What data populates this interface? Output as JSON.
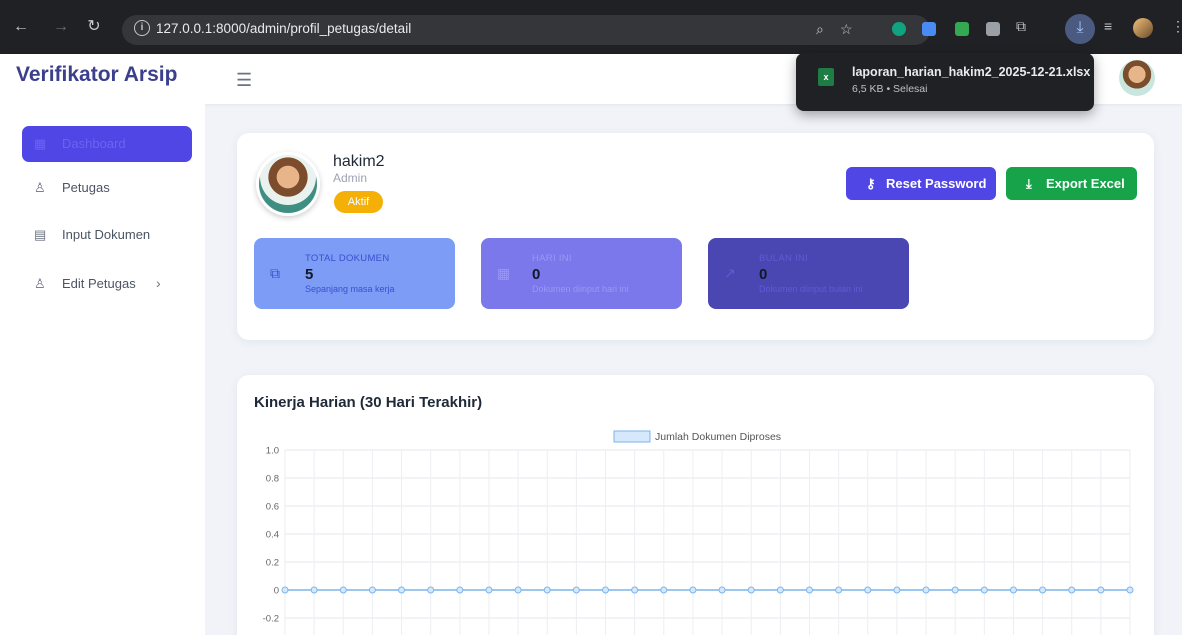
{
  "browser": {
    "url": "127.0.0.1:8000/admin/profil_petugas/detail",
    "download": {
      "filename": "laporan_harian_hakim2_2025-12-21.xlsx",
      "meta": "6,5 KB • Selesai"
    }
  },
  "header": {
    "brand": "Verifikator Arsip"
  },
  "sidebar": {
    "items": [
      {
        "label": "Dashboard",
        "icon": "dashboard-icon"
      },
      {
        "label": "Petugas",
        "icon": "user-icon"
      },
      {
        "label": "Input Dokumen",
        "icon": "document-icon"
      },
      {
        "label": "Edit Petugas",
        "icon": "user-icon"
      }
    ]
  },
  "profile": {
    "name": "hakim2",
    "role": "Admin",
    "status": "Aktif",
    "reset_label": "Reset Password",
    "export_label": "Export Excel"
  },
  "stats": [
    {
      "label": "TOTAL DOKUMEN",
      "value": "5",
      "sub": "Sepanjang masa kerja",
      "icon": "copy-icon"
    },
    {
      "label": "HARI INI",
      "value": "0",
      "sub": "Dokumen diinput hari ini",
      "icon": "calendar-icon"
    },
    {
      "label": "BULAN INI",
      "value": "0",
      "sub": "Dokumen diinput bulan ini",
      "icon": "chart-line-icon"
    }
  ],
  "colors": {
    "primary": "#4f46e5",
    "success": "#16a34a",
    "warning": "#f5b007",
    "line": "#7cb5ec"
  },
  "chart_data": {
    "type": "line",
    "title": "Kinerja Harian (30 Hari Terakhir)",
    "legend_position": "top-center",
    "y_ticks": [
      "1.0",
      "0.8",
      "0.6",
      "0.4",
      "0.2",
      "0",
      "-0.2"
    ],
    "ylim": [
      -0.3,
      1.0
    ],
    "grid": true,
    "series": [
      {
        "name": "Jumlah Dokumen Diproses",
        "values": [
          0,
          0,
          0,
          0,
          0,
          0,
          0,
          0,
          0,
          0,
          0,
          0,
          0,
          0,
          0,
          0,
          0,
          0,
          0,
          0,
          0,
          0,
          0,
          0,
          0,
          0,
          0,
          0,
          0,
          0
        ]
      }
    ]
  }
}
